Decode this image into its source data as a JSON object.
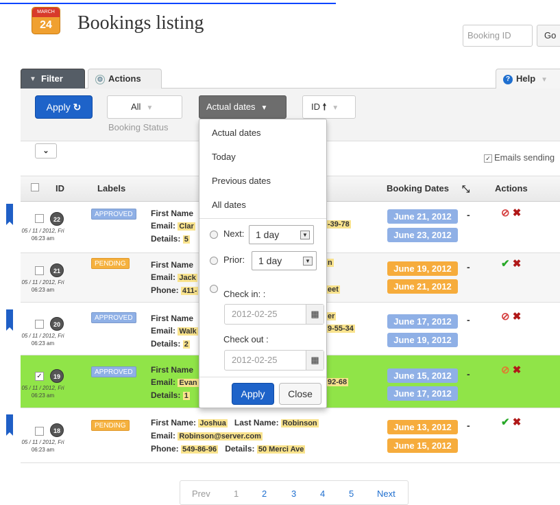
{
  "header": {
    "calendar_month": "MARCH",
    "calendar_day": "24",
    "title": "Bookings listing",
    "booking_id_placeholder": "Booking ID",
    "go_label": "Go"
  },
  "tabs": {
    "filter": "Filter",
    "actions": "Actions",
    "help": "Help"
  },
  "toolbar": {
    "apply_label": "Apply",
    "status_value": "All",
    "status_caption": "Booking Status",
    "dates_value": "Actual dates",
    "sort_value": "ID",
    "emails_label": "Emails sending"
  },
  "table": {
    "headers": [
      "ID",
      "Labels",
      "Booking Dates",
      "Actions"
    ],
    "rows": [
      {
        "id": "22",
        "date": "05 / 11 / 2012, Fri",
        "time": "06:23 am",
        "label": "APPROVED",
        "line1": "First Name",
        "line2": "Email:",
        "line2_val": "Clar",
        "line2_tail": "-39-78",
        "line3": "Details:",
        "line3_val": "5",
        "start": "June 21, 2012",
        "end": "June 23, 2012",
        "flag": true,
        "checked": false
      },
      {
        "id": "21",
        "date": "05 / 11 / 2012, Fri",
        "time": "06:23 am",
        "label": "PENDING",
        "line1": "First Name",
        "line2": "Email:",
        "line2_val": "Jack",
        "line2_tail": "n",
        "line3": "Phone:",
        "line3_val": "411-",
        "line3_tail": "eet",
        "start": "June 19, 2012",
        "end": "June 21, 2012",
        "flag": false,
        "checked": false
      },
      {
        "id": "20",
        "date": "05 / 11 / 2012, Fri",
        "time": "06:23 am",
        "label": "APPROVED",
        "line1": "First Name",
        "line2": "Email:",
        "line2_val": "Walk",
        "line1_tail": "er",
        "line2_tail": "9-55-34",
        "line3": "Details:",
        "line3_val": "2",
        "start": "June 17, 2012",
        "end": "June 19, 2012",
        "flag": true,
        "checked": false
      },
      {
        "id": "19",
        "date": "05 / 11 / 2012, Fri",
        "time": "06:23 am",
        "label": "APPROVED",
        "line1": "First Name",
        "line2": "Email:",
        "line2_val": "Evan",
        "line2_tail": "92-68",
        "line3": "Details:",
        "line3_val": "1",
        "start": "June 15, 2012",
        "end": "June 17, 2012",
        "flag": false,
        "checked": true
      },
      {
        "id": "18",
        "date": "05 / 11 / 2012, Fri",
        "time": "06:23 am",
        "label": "PENDING",
        "first_name_label": "First Name:",
        "first_name": "Joshua",
        "last_name_label": "Last Name:",
        "last_name": "Robinson",
        "email_label": "Email:",
        "email": "Robinson@server.com",
        "phone_label": "Phone:",
        "phone": "549-86-96",
        "details_label": "Details:",
        "details": "50 Merci Ave",
        "start": "June 13, 2012",
        "end": "June 15, 2012",
        "flag": true,
        "checked": false
      }
    ]
  },
  "pagination": {
    "prev": "Prev",
    "pages": [
      "1",
      "2",
      "3",
      "4",
      "5"
    ],
    "next": "Next"
  },
  "dropdown": {
    "options": [
      "Actual dates",
      "Today",
      "Previous dates",
      "All dates"
    ],
    "next_label": "Next:",
    "next_value": "1 day",
    "prior_label": "Prior:",
    "prior_value": "1 day",
    "checkin_label": "Check in: :",
    "checkin_value": "2012-02-25",
    "checkout_label": "Check out :",
    "checkout_value": "2012-02-25",
    "apply_label": "Apply",
    "close_label": "Close"
  },
  "colors": {
    "primary_button": "#1e63c9",
    "approved": "#8fb0e6",
    "pending": "#f5b13e",
    "selected_row": "#90e448"
  }
}
